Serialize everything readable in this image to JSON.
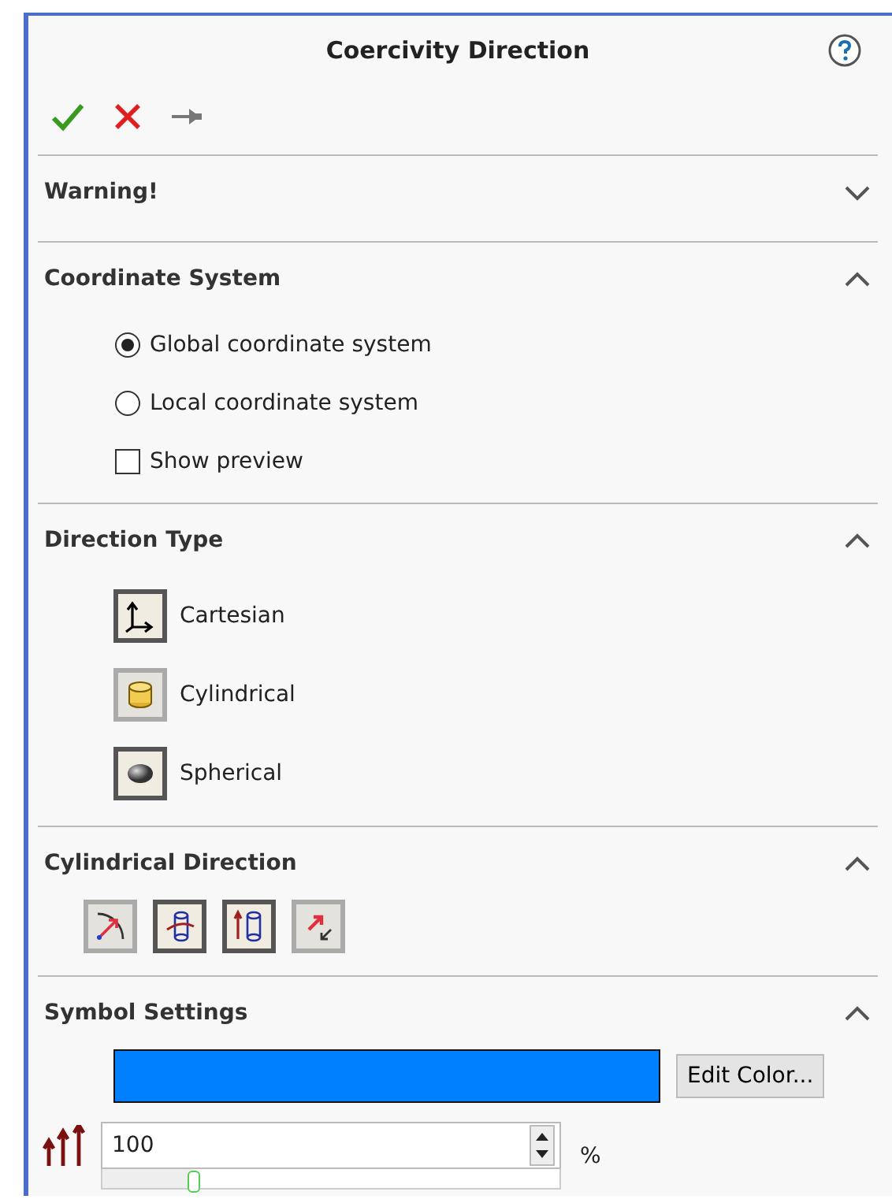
{
  "title": "Coercivity Direction",
  "sections": [
    {
      "title": "Warning!",
      "expanded": false
    },
    {
      "kind": "options",
      "title": "Coordinate System",
      "expanded": true,
      "options": [
        {
          "kind": "radio",
          "label": "Global coordinate system",
          "selected": true
        },
        {
          "kind": "radio",
          "label": "Local coordinate system",
          "selected": false
        },
        {
          "kind": "checkbox",
          "label": "Show preview",
          "checked": false
        }
      ]
    },
    {
      "kind": "types",
      "title": "Direction Type",
      "expanded": true,
      "types": [
        {
          "label": "Cartesian",
          "selected": false
        },
        {
          "label": "Cylindrical",
          "selected": true
        },
        {
          "label": "Spherical",
          "selected": false
        }
      ]
    },
    {
      "kind": "toggles",
      "title": "Cylindrical Direction",
      "expanded": true,
      "toggles": [
        {
          "selected": true
        },
        {
          "selected": false
        },
        {
          "selected": false
        },
        {
          "selected": true
        }
      ]
    },
    {
      "kind": "symbol",
      "title": "Symbol Settings",
      "expanded": true,
      "color": "#0080ff",
      "edit_button": "Edit Color...",
      "size": {
        "value": "100",
        "unit": "%",
        "level": 0.2
      }
    }
  ]
}
